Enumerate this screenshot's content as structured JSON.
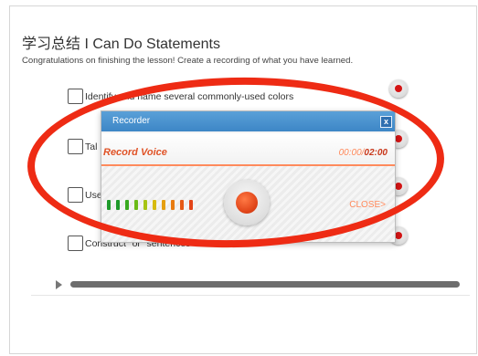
{
  "page": {
    "title": "学习总结 I Can Do Statements",
    "subtitle": "Congratulations on finishing the lesson! Create a recording of what you have learned."
  },
  "statements": [
    {
      "text": "Identify and name several commonly-used colors"
    },
    {
      "text": "Tal"
    },
    {
      "text": "Use"
    },
    {
      "text": "Construct \"or\" sentences"
    }
  ],
  "recorder": {
    "header": "Recorder",
    "close_x": "x",
    "status": "Record Voice",
    "time_current": "00:00/",
    "time_total": "02:00",
    "close_label": "CLOSE>",
    "level_colors": [
      "#1e9a2a",
      "#1e9a2a",
      "#3aaa20",
      "#6cbb18",
      "#a7c414",
      "#d7bb10",
      "#e59f10",
      "#e87c12",
      "#e65a16",
      "#e34418"
    ]
  },
  "colors": {
    "annotation": "#ee2b14",
    "header_blue": "#3d86c6",
    "accent_orange": "#e05327"
  }
}
